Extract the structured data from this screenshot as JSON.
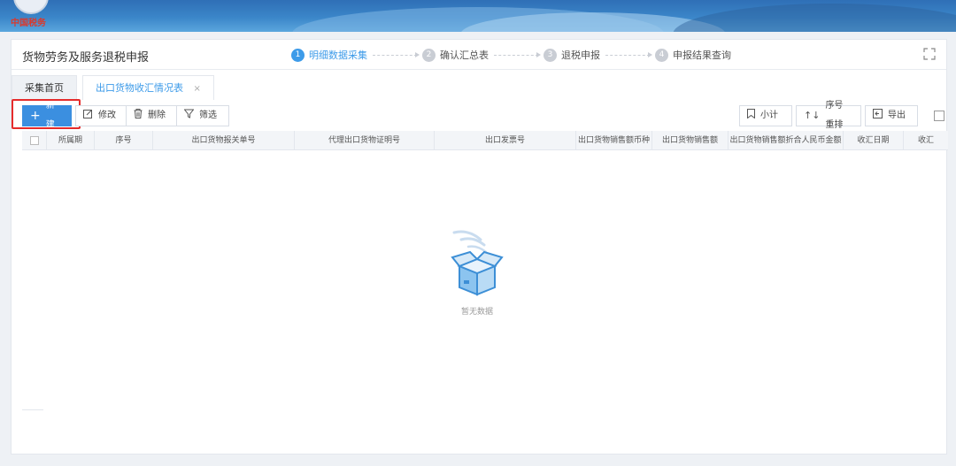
{
  "app": {
    "title": "",
    "brand": "中国税务"
  },
  "header": {
    "page_title": "货物劳务及服务退税申报",
    "steps": [
      {
        "num": "1",
        "label": "明细数据采集",
        "active": true
      },
      {
        "num": "2",
        "label": "确认汇总表",
        "active": false
      },
      {
        "num": "3",
        "label": "退税申报",
        "active": false
      },
      {
        "num": "4",
        "label": "申报结果查询",
        "active": false
      }
    ]
  },
  "tabs": [
    {
      "label": "采集首页",
      "active": false
    },
    {
      "label": "出口货物收汇情况表",
      "active": true,
      "close": "×"
    }
  ],
  "toolbar": {
    "new_label": "新建",
    "edit_label": "修改",
    "delete_label": "删除",
    "filter_label": "筛选",
    "subtotal_label": "小计",
    "reorder_label": "序号重排",
    "export_label": "导出"
  },
  "table": {
    "columns": [
      "所属期",
      "序号",
      "出口货物报关单号",
      "代理出口货物证明号",
      "出口发票号",
      "出口货物销售额币种",
      "出口货物销售额",
      "出口货物销售额折合人民币金额",
      "收汇日期",
      "收汇"
    ]
  },
  "empty_state": {
    "text": "暂无数据"
  },
  "colors": {
    "accent": "#3d9be9",
    "primary_button": "#3b8fe0",
    "highlight_border": "#e52b2b"
  }
}
